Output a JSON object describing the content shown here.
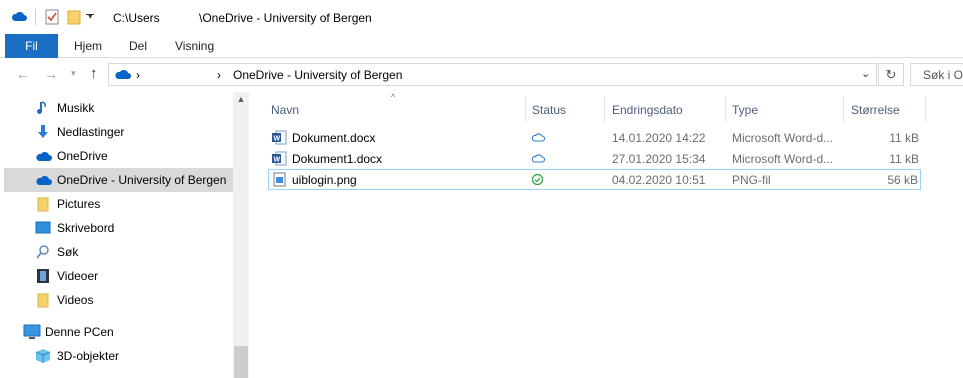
{
  "window": {
    "path_prefix": "C:\\Users",
    "path_suffix": "\\OneDrive - University of Bergen"
  },
  "ribbon": {
    "tabs": [
      "Fil",
      "Hjem",
      "Del",
      "Visning"
    ]
  },
  "address": {
    "crumb_sep1": "›",
    "crumb_sep2": "›",
    "crumb_location": "OneDrive - University of Bergen",
    "search_placeholder": "Søk i On"
  },
  "sidebar": {
    "items": [
      {
        "label": "Musikk",
        "icon": "music-icon"
      },
      {
        "label": "Nedlastinger",
        "icon": "download-icon"
      },
      {
        "label": "OneDrive",
        "icon": "cloud-icon"
      },
      {
        "label": "OneDrive - University of Bergen",
        "icon": "cloud-icon",
        "selected": true
      },
      {
        "label": "Pictures",
        "icon": "folder-icon"
      },
      {
        "label": "Skrivebord",
        "icon": "desktop-icon"
      },
      {
        "label": "Søk",
        "icon": "search-icon"
      },
      {
        "label": "Videoer",
        "icon": "film-icon"
      },
      {
        "label": "Videos",
        "icon": "folder-icon"
      },
      {
        "label": "Denne PCen",
        "icon": "computer-icon"
      },
      {
        "label": "3D-objekter",
        "icon": "cube-icon"
      }
    ]
  },
  "columns": {
    "name": "Navn",
    "status": "Status",
    "date": "Endringsdato",
    "type": "Type",
    "size": "Størrelse"
  },
  "files": [
    {
      "name": "Dokument.docx",
      "status": "cloud",
      "date": "14.01.2020 14:22",
      "type": "Microsoft Word-d...",
      "size": "11 kB",
      "icon": "word-icon"
    },
    {
      "name": "Dokument1.docx",
      "status": "cloud",
      "date": "27.01.2020 15:34",
      "type": "Microsoft Word-d...",
      "size": "11 kB",
      "icon": "word-icon"
    },
    {
      "name": "uiblogin.png",
      "status": "synced",
      "date": "04.02.2020 10:51",
      "type": "PNG-fil",
      "size": "56 kB",
      "icon": "image-icon"
    }
  ],
  "colors": {
    "accent": "#1a6fc4",
    "onedrive": "#0a64c8",
    "folder": "#f7d26c",
    "selected_bg": "#d9d9d9",
    "status_green": "#2e9e3a"
  }
}
